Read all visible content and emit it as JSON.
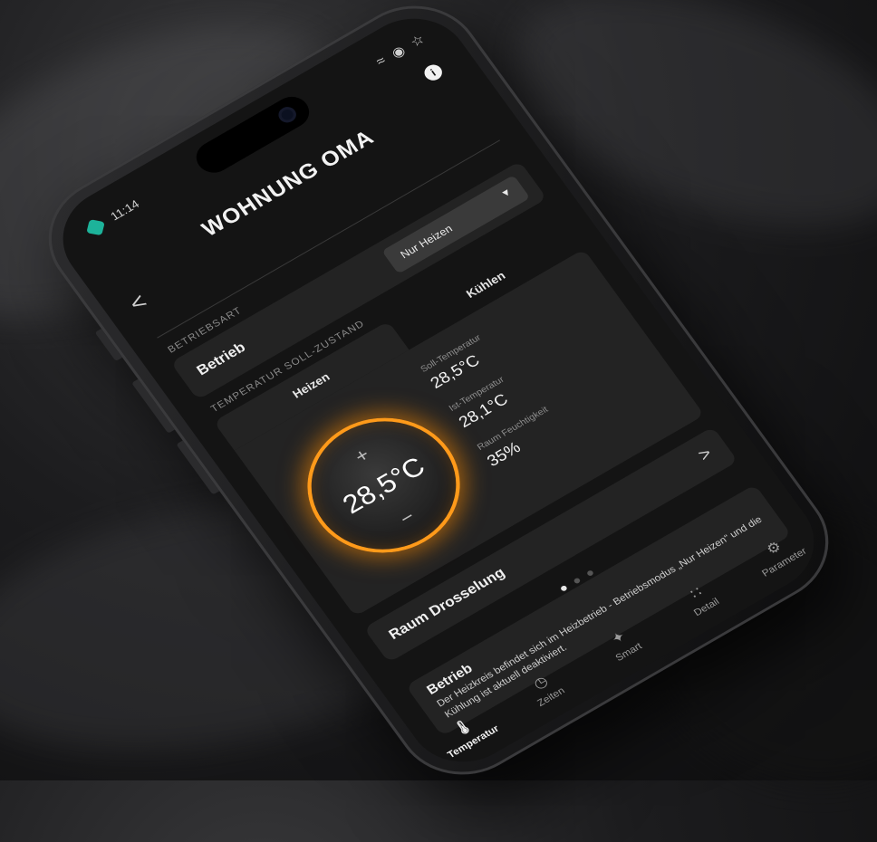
{
  "status_bar": {
    "time": "11:14",
    "icons": [
      "wifi-icon",
      "user-location-icon",
      "star-icon"
    ]
  },
  "header": {
    "title": "WOHNUNG OMA",
    "info_label": "i",
    "back_glyph": "<"
  },
  "betriebsart": {
    "section_label": "BETRIEBSART",
    "row_label": "Betrieb",
    "select_value": "Nur Heizen"
  },
  "soll_zustand": {
    "section_label": "TEMPERATUR SOLL-ZUSTAND",
    "tabs": [
      {
        "label": "Heizen"
      },
      {
        "label": "Kühlen"
      }
    ],
    "dial": {
      "value": "28,5°C",
      "plus": "+",
      "minus": "−"
    },
    "readings": [
      {
        "label": "Soll-Temperatur",
        "value": "28,5°C"
      },
      {
        "label": "Ist-Temperatur",
        "value": "28,1°C"
      },
      {
        "label": "Raum Feuchtigkeit",
        "value": "35%"
      }
    ]
  },
  "raum_drosselung": {
    "label": "Raum Drosselung",
    "arrow": ">"
  },
  "pager": {
    "pages": 3,
    "active": 0
  },
  "message": {
    "title": "Betrieb",
    "text": "Der Heizkreis befindet sich im Heizbetrieb - Betriebsmodus „Nur Heizen“ und die Kühlung ist aktuell deaktiviert."
  },
  "bottom_nav": [
    {
      "label": "Temperatur",
      "icon": "thermometer-icon",
      "active": true
    },
    {
      "label": "Zeiten",
      "icon": "clock-icon",
      "active": false
    },
    {
      "label": "Smart",
      "icon": "wand-icon",
      "active": false
    },
    {
      "label": "Detail",
      "icon": "grid-icon",
      "active": false
    },
    {
      "label": "Parameter",
      "icon": "gear-icon",
      "active": false
    }
  ],
  "colors": {
    "accent": "#ff9a1a",
    "app_icon": "#1db39a",
    "card": "#232323",
    "screen": "#141414"
  }
}
